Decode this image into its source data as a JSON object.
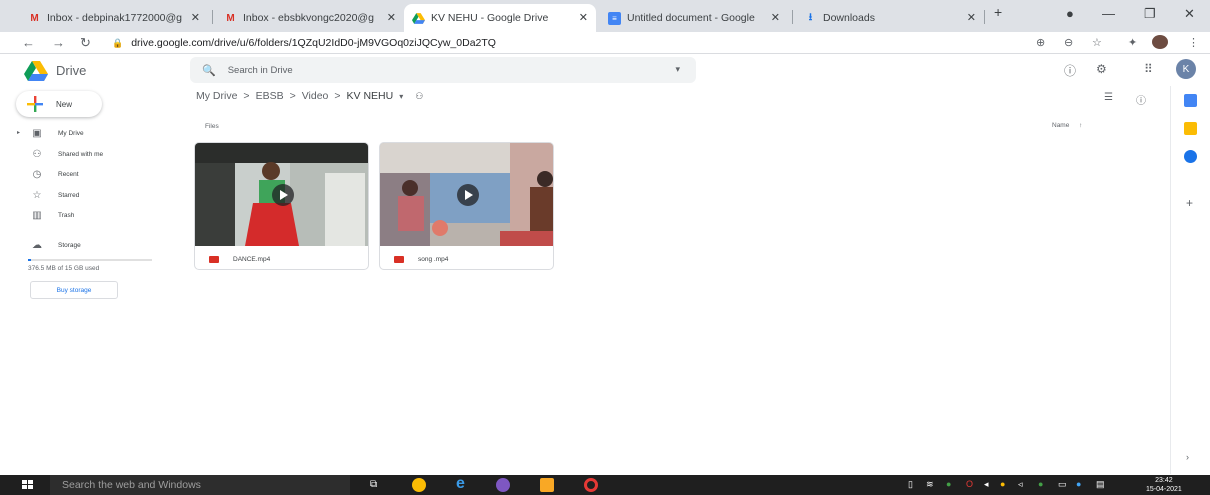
{
  "browser": {
    "tabs": [
      {
        "label": "Inbox - debpinak1772000@g",
        "icon": "gmail-icon",
        "active": false
      },
      {
        "label": "Inbox - ebsbkvongc2020@g",
        "icon": "gmail-icon",
        "active": false
      },
      {
        "label": "KV NEHU - Google Drive",
        "icon": "drive-icon",
        "active": true
      },
      {
        "label": "Untitled document - Google",
        "icon": "docs-icon",
        "active": false
      },
      {
        "label": "Downloads",
        "icon": "download-icon",
        "active": false
      }
    ],
    "new_tab": "+",
    "url": "drive.google.com/drive/u/6/folders/1QZqU2IdD0-jM9VGOq0ziJQCyw_0Da2TQ"
  },
  "drive": {
    "title": "Drive",
    "search_placeholder": "Search in Drive",
    "avatar_letter": "K",
    "new_label": "New",
    "nav": [
      {
        "label": "My Drive",
        "icon": "my-drive-icon",
        "glyph": "▣"
      },
      {
        "label": "Shared with me",
        "icon": "shared-icon",
        "glyph": "👥"
      },
      {
        "label": "Recent",
        "icon": "clock-icon",
        "glyph": "◷"
      },
      {
        "label": "Starred",
        "icon": "star-icon",
        "glyph": "☆"
      },
      {
        "label": "Trash",
        "icon": "trash-icon",
        "glyph": "🗑"
      }
    ],
    "storage_label": "Storage",
    "storage_used": "376.5 MB of 15 GB used",
    "storage_fraction": 0.025,
    "buy_storage": "Buy storage",
    "breadcrumb": [
      "My Drive",
      "EBSB",
      "Video",
      "KV NEHU"
    ],
    "files_label": "Files",
    "sort_label": "Name",
    "files": [
      {
        "name": "DANCE.mp4",
        "type": "video"
      },
      {
        "name": "song .mp4",
        "type": "video"
      }
    ]
  },
  "taskbar": {
    "search_placeholder": "Search the web and Windows",
    "time": "23:42",
    "date": "15-04-2021"
  },
  "colors": {
    "accent": "#1a73e8",
    "video_icon": "#d93025",
    "taskbar": "#1f1f1f"
  }
}
